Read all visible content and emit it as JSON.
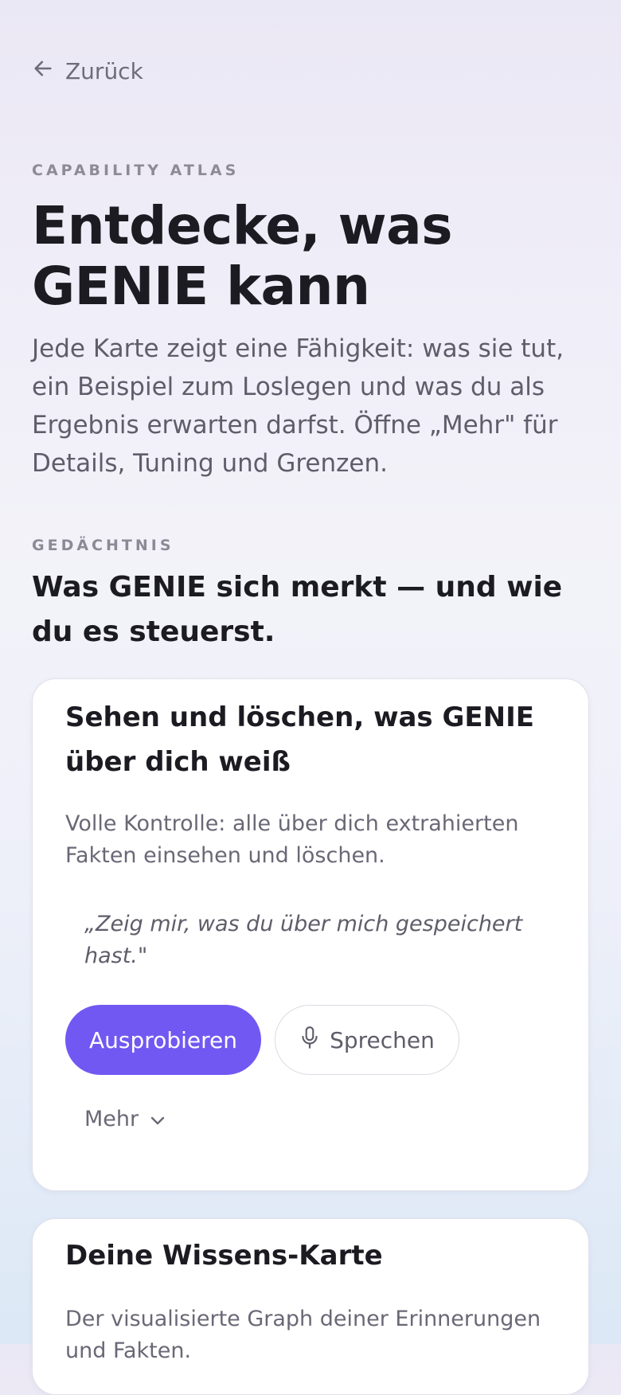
{
  "nav": {
    "back_label": "Zurück"
  },
  "hero": {
    "eyebrow": "CAPABILITY ATLAS",
    "title": "Entdecke, was GENIE kann",
    "description": "Jede Karte zeigt eine Fähigkeit: was sie tut, ein Beispiel zum Loslegen und was du als Ergebnis erwarten darfst. Öffne „Mehr\" für Details, Tuning und Grenzen."
  },
  "section": {
    "eyebrow": "GEDÄCHTNIS",
    "title": "Was GENIE sich merkt — und wie du es steuerst."
  },
  "cards": [
    {
      "title": "Sehen und löschen, was GENIE über dich weiß",
      "description": "Volle Kontrolle: alle über dich extrahierten Fakten einsehen und löschen.",
      "example": "„Zeig mir, was du über mich gespeichert hast.\"",
      "try_label": "Ausprobieren",
      "speak_label": "Sprechen",
      "more_label": "Mehr"
    },
    {
      "title": "Deine Wissens-Karte",
      "description": "Der visualisierte Graph deiner Erinnerungen und Fakten."
    }
  ],
  "icons": {
    "back": "arrow-left-icon",
    "speak": "microphone-icon",
    "more": "chevron-down-icon"
  },
  "colors": {
    "accent": "#7158f2",
    "text": "#1c1b22",
    "muted": "#6a6876"
  }
}
